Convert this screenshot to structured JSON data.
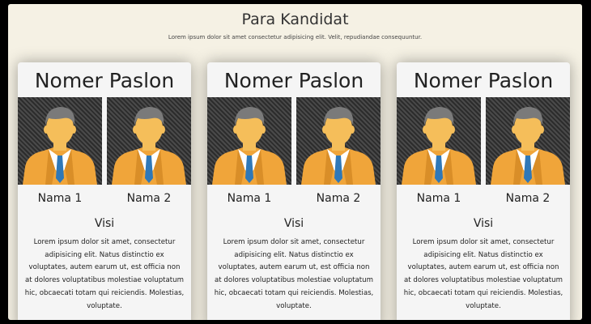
{
  "page": {
    "title": "Para Kandidat",
    "subtitle": "Lorem ipsum dolor sit amet consectetur adipisicing elit. Velit, repudiandae consequuntur."
  },
  "cards": [
    {
      "title": "Nomer Paslon",
      "candidates": [
        {
          "name": "Nama 1",
          "photo_icon": "person-avatar-icon"
        },
        {
          "name": "Nama 2",
          "photo_icon": "person-avatar-icon"
        }
      ],
      "visi_title": "Visi",
      "visi_text": "Lorem ipsum dolor sit amet, consectetur adipisicing elit. Natus distinctio ex voluptates, autem earum ut, est officia non at dolores voluptatibus molestiae voluptatum hic, obcaecati totam qui reiciendis. Molestias, voluptate."
    },
    {
      "title": "Nomer Paslon",
      "candidates": [
        {
          "name": "Nama 1",
          "photo_icon": "person-avatar-icon"
        },
        {
          "name": "Nama 2",
          "photo_icon": "person-avatar-icon"
        }
      ],
      "visi_title": "Visi",
      "visi_text": "Lorem ipsum dolor sit amet, consectetur adipisicing elit. Natus distinctio ex voluptates, autem earum ut, est officia non at dolores voluptatibus molestiae voluptatum hic, obcaecati totam qui reiciendis. Molestias, voluptate."
    },
    {
      "title": "Nomer Paslon",
      "candidates": [
        {
          "name": "Nama 1",
          "photo_icon": "person-avatar-icon"
        },
        {
          "name": "Nama 2",
          "photo_icon": "person-avatar-icon"
        }
      ],
      "visi_title": "Visi",
      "visi_text": "Lorem ipsum dolor sit amet, consectetur adipisicing elit. Natus distinctio ex voluptates, autem earum ut, est officia non at dolores voluptatibus molestiae voluptatum hic, obcaecati totam qui reiciendis. Molestias, voluptate."
    }
  ],
  "colors": {
    "page_background": "#f5f1e4",
    "card_background": "#f5f5f5",
    "avatar_suit": "#f0a53a",
    "avatar_skin": "#f5be5a",
    "avatar_hair": "#7a7a7a",
    "avatar_tie": "#2f78b8"
  }
}
